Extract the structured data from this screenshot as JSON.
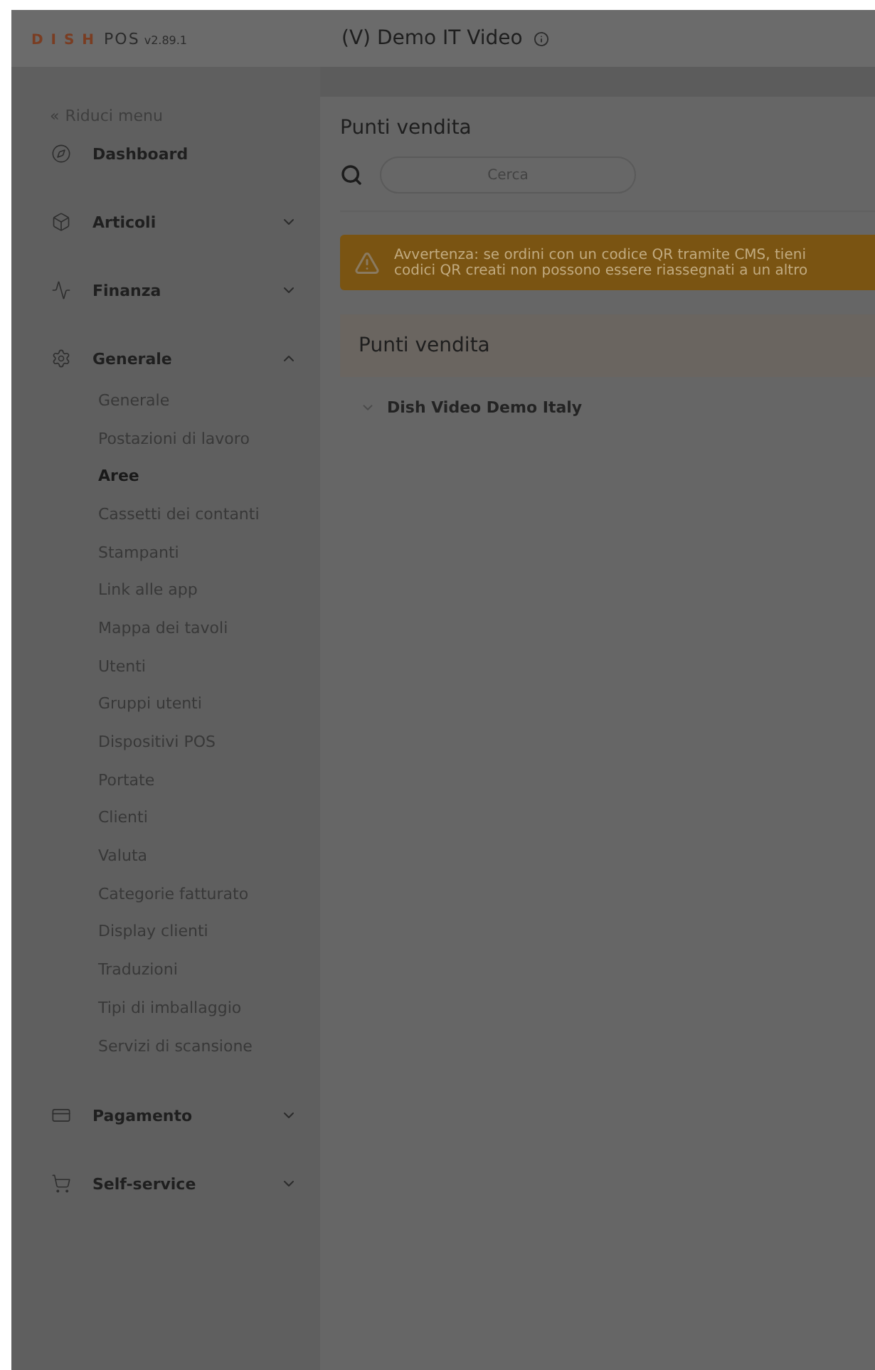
{
  "header": {
    "brand": "D I S H",
    "product": "POS",
    "version": "v2.89.1",
    "title": "(V) Demo IT Video"
  },
  "sidebar": {
    "collapse": {
      "glyph": "«",
      "label": "Riduci menu"
    },
    "items": [
      {
        "kind": "link",
        "label": "Dashboard"
      },
      {
        "kind": "group",
        "label": "Articoli",
        "expanded": false
      },
      {
        "kind": "group",
        "label": "Finanza",
        "expanded": false
      },
      {
        "kind": "group",
        "label": "Generale",
        "expanded": true,
        "children": [
          {
            "label": "Generale",
            "selected": false
          },
          {
            "label": "Postazioni di lavoro",
            "selected": false
          },
          {
            "label": "Aree",
            "selected": true
          },
          {
            "label": "Cassetti dei contanti",
            "selected": false
          },
          {
            "label": "Stampanti",
            "selected": false
          },
          {
            "label": "Link alle app",
            "selected": false
          },
          {
            "label": "Mappa dei tavoli",
            "selected": false
          },
          {
            "label": "Utenti",
            "selected": false
          },
          {
            "label": "Gruppi utenti",
            "selected": false
          },
          {
            "label": "Dispositivi POS",
            "selected": false
          },
          {
            "label": "Portate",
            "selected": false
          },
          {
            "label": "Clienti",
            "selected": false
          },
          {
            "label": "Valuta",
            "selected": false
          },
          {
            "label": "Categorie fatturato",
            "selected": false
          },
          {
            "label": "Display clienti",
            "selected": false
          },
          {
            "label": "Traduzioni",
            "selected": false
          },
          {
            "label": "Tipi di imballaggio",
            "selected": false
          },
          {
            "label": "Servizi di scansione",
            "selected": false
          }
        ]
      },
      {
        "kind": "group",
        "label": "Pagamento",
        "expanded": false
      },
      {
        "kind": "group",
        "label": "Self-service",
        "expanded": false
      }
    ]
  },
  "main": {
    "title": "Punti vendita",
    "search": {
      "placeholder": "Cerca"
    },
    "warning": {
      "lines": [
        "Avvertenza: se ordini con un codice QR tramite CMS, tieni",
        "codici QR creati non possono essere riassegnati a un altro"
      ]
    },
    "section": {
      "title": "Punti vendita"
    },
    "tree": [
      {
        "label": "Dish Video Demo Italy",
        "expanded": false
      }
    ]
  }
}
